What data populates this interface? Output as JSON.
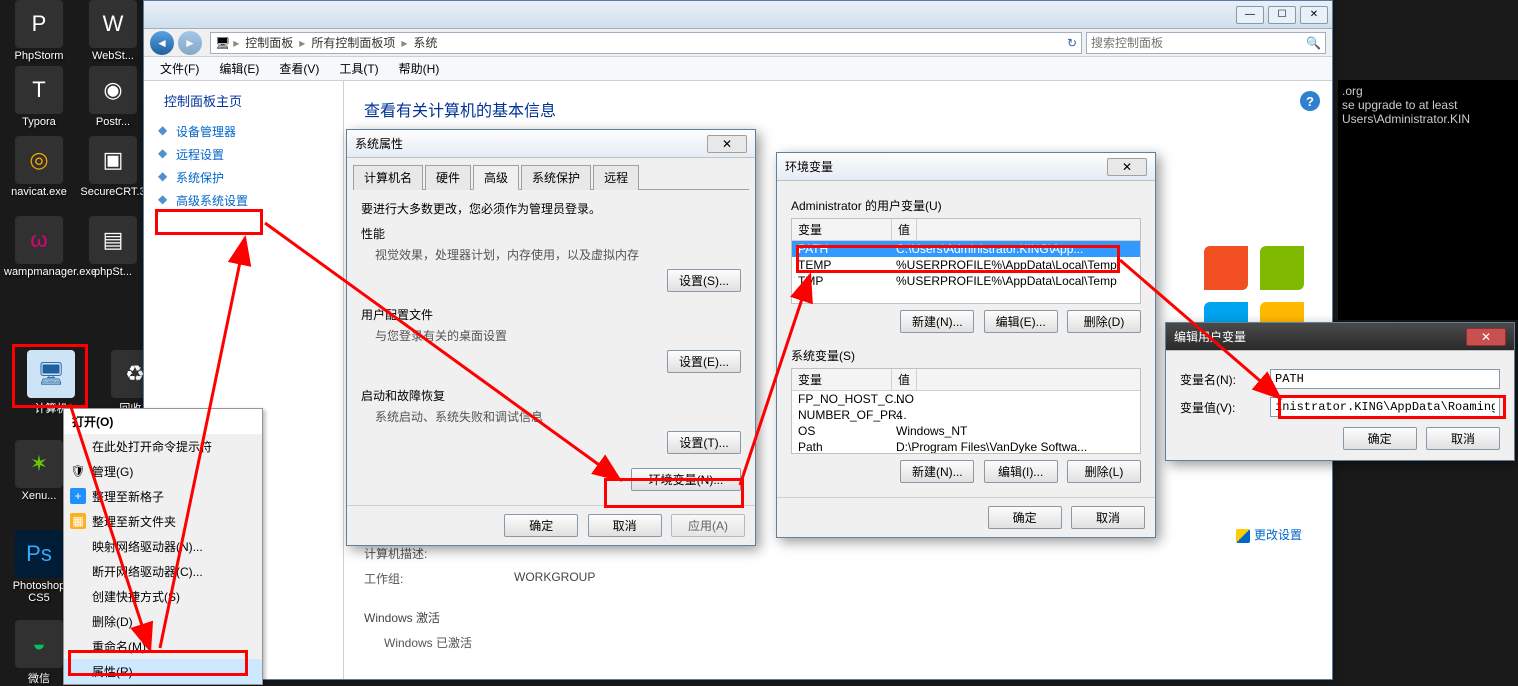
{
  "desktop": {
    "icons": [
      {
        "label": "PhpStorm"
      },
      {
        "label": "WebSt..."
      },
      {
        "label": "Typora"
      },
      {
        "label": "Postr..."
      },
      {
        "label": "navicat.exe"
      },
      {
        "label": "SecureCRT.3"
      },
      {
        "label": "wampmanager.exe"
      },
      {
        "label": "phpSt..."
      },
      {
        "label": "计算机"
      },
      {
        "label": "回收..."
      },
      {
        "label": "Xenu..."
      },
      {
        "label": "Photoshop CS5"
      },
      {
        "label": "微信"
      }
    ]
  },
  "context_menu": {
    "title": "打开(O)",
    "items": [
      "在此处打开命令提示符",
      "管理(G)",
      "整理至新格子",
      "整理至新文件夹",
      "映射网络驱动器(N)...",
      "断开网络驱动器(C)...",
      "创建快捷方式(S)",
      "删除(D)",
      "重命名(M)",
      "属性(R)"
    ]
  },
  "main_window": {
    "win_buttons": {
      "min": "—",
      "max": "☐",
      "close": "✕"
    },
    "breadcrumb": [
      "控制面板",
      "所有控制面板项",
      "系统"
    ],
    "search_placeholder": "搜索控制面板",
    "menus": [
      "文件(F)",
      "编辑(E)",
      "查看(V)",
      "工具(T)",
      "帮助(H)"
    ],
    "sidebar": {
      "title": "控制面板主页",
      "items": [
        "设备管理器",
        "远程设置",
        "系统保护",
        "高级系统设置"
      ]
    },
    "header": "查看有关计算机的基本信息",
    "computer_desc_label": "计算机描述:",
    "workgroup_label": "工作组:",
    "workgroup_value": "WORKGROUP",
    "activation_label": "Windows 激活",
    "activation_text": "Windows 已激活",
    "change_settings": "更改设置"
  },
  "sys_props": {
    "title": "系统属性",
    "tabs": [
      "计算机名",
      "硬件",
      "高级",
      "系统保护",
      "远程"
    ],
    "admin_note": "要进行大多数更改，您必须作为管理员登录。",
    "groups": [
      {
        "t": "性能",
        "d": "视觉效果，处理器计划，内存使用，以及虚拟内存",
        "b": "设置(S)..."
      },
      {
        "t": "用户配置文件",
        "d": "与您登录有关的桌面设置",
        "b": "设置(E)..."
      },
      {
        "t": "启动和故障恢复",
        "d": "系统启动、系统失败和调试信息",
        "b": "设置(T)..."
      }
    ],
    "env_button": "环境变量(N)...",
    "ok": "确定",
    "cancel": "取消",
    "apply": "应用(A)"
  },
  "env_vars": {
    "title": "环境变量",
    "user_section": "Administrator 的用户变量(U)",
    "headers": {
      "var": "变量",
      "val": "值"
    },
    "user_vars": [
      {
        "name": "PATH",
        "value": "C:\\Users\\Administrator.KING\\App..."
      },
      {
        "name": "TEMP",
        "value": "%USERPROFILE%\\AppData\\Local\\Temp"
      },
      {
        "name": "TMP",
        "value": "%USERPROFILE%\\AppData\\Local\\Temp"
      }
    ],
    "sys_section": "系统变量(S)",
    "sys_vars": [
      {
        "name": "变量",
        "value": "值"
      },
      {
        "name": "FP_NO_HOST_C...",
        "value": "NO"
      },
      {
        "name": "NUMBER_OF_PR...",
        "value": "4"
      },
      {
        "name": "OS",
        "value": "Windows_NT"
      },
      {
        "name": "Path",
        "value": "D:\\Program Files\\VanDyke Softwa..."
      }
    ],
    "new": "新建(N)...",
    "edit_u": "编辑(E)...",
    "del_u": "删除(D)",
    "edit_s": "编辑(I)...",
    "del_s": "删除(L)",
    "ok": "确定",
    "cancel": "取消"
  },
  "edit_var": {
    "title": "编辑用户变量",
    "name_label": "变量名(N):",
    "name_value": "PATH",
    "value_label": "变量值(V):",
    "value_value": "inistrator.KING\\AppData\\Roaming\\npm",
    "ok": "确定",
    "cancel": "取消",
    "close": "✕"
  },
  "terminal": {
    "lines": [
      ".org",
      "se upgrade to at least",
      "",
      "Users\\Administrator.KIN"
    ]
  }
}
